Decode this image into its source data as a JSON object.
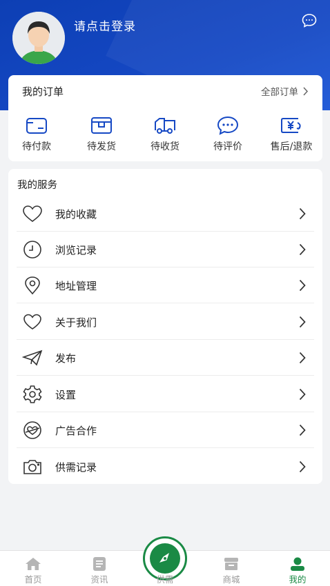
{
  "header": {
    "login_prompt": "请点击登录",
    "colors": {
      "header_bg": "#1548c4",
      "accent_green": "#1a8a45"
    }
  },
  "orders": {
    "title": "我的订单",
    "all_label": "全部订单",
    "items": [
      {
        "label": "待付款",
        "icon": "wallet-icon"
      },
      {
        "label": "待发货",
        "icon": "package-icon"
      },
      {
        "label": "待收货",
        "icon": "truck-icon"
      },
      {
        "label": "待评价",
        "icon": "comment-icon"
      },
      {
        "label": "售后/退款",
        "icon": "refund-icon"
      }
    ]
  },
  "services": {
    "title": "我的服务",
    "items": [
      {
        "label": "我的收藏",
        "icon": "heart-icon"
      },
      {
        "label": "浏览记录",
        "icon": "clock-icon"
      },
      {
        "label": "地址管理",
        "icon": "location-pin-icon"
      },
      {
        "label": "关于我们",
        "icon": "heart-outline-icon"
      },
      {
        "label": "发布",
        "icon": "paper-plane-icon"
      },
      {
        "label": "设置",
        "icon": "gear-icon"
      },
      {
        "label": "广告合作",
        "icon": "ad-badge-icon"
      },
      {
        "label": "供需记录",
        "icon": "camera-icon"
      }
    ]
  },
  "tabbar": {
    "items": [
      {
        "label": "首页",
        "icon": "home-icon",
        "active": false
      },
      {
        "label": "资讯",
        "icon": "news-icon",
        "active": false
      },
      {
        "label": "供需",
        "icon": "compass-icon",
        "active": false
      },
      {
        "label": "商城",
        "icon": "shop-icon",
        "active": false
      },
      {
        "label": "我的",
        "icon": "user-icon",
        "active": true
      }
    ]
  }
}
